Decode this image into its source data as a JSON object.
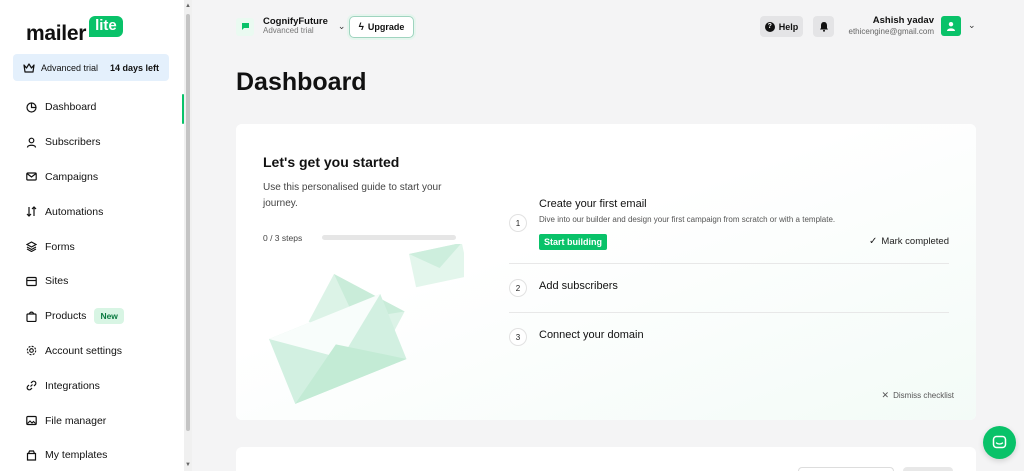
{
  "logo": {
    "text": "mailer",
    "badge": "lite"
  },
  "trial": {
    "label": "Advanced trial",
    "days_left": "14 days left"
  },
  "sidebar": {
    "items": [
      {
        "label": "Dashboard",
        "icon": "dashboard-icon",
        "active": true
      },
      {
        "label": "Subscribers",
        "icon": "user-icon"
      },
      {
        "label": "Campaigns",
        "icon": "mail-icon"
      },
      {
        "label": "Automations",
        "icon": "automation-icon"
      },
      {
        "label": "Forms",
        "icon": "layers-icon"
      },
      {
        "label": "Sites",
        "icon": "browser-icon"
      },
      {
        "label": "Products",
        "icon": "bag-icon",
        "badge": "New"
      },
      {
        "label": "Account settings",
        "icon": "gear-icon"
      },
      {
        "label": "Integrations",
        "icon": "link-icon"
      },
      {
        "label": "File manager",
        "icon": "image-icon"
      },
      {
        "label": "My templates",
        "icon": "template-icon"
      }
    ]
  },
  "account": {
    "name": "CognifyFuture",
    "plan": "Advanced trial"
  },
  "header": {
    "upgrade_label": "Upgrade",
    "help_label": "Help"
  },
  "user": {
    "name": "Ashish yadav",
    "email": "ethicengine@gmail.com"
  },
  "page": {
    "title": "Dashboard"
  },
  "guide": {
    "title": "Let's get you started",
    "description": "Use this personalised guide to start your journey.",
    "steps_count": "0 / 3 steps",
    "progress": 0,
    "dismiss_label": "Dismiss checklist",
    "steps": [
      {
        "num": "1",
        "title": "Create your first email",
        "subtitle": "Dive into our builder and design your first campaign from scratch or with a template.",
        "action": "Start building",
        "mark_completed": "Mark completed"
      },
      {
        "num": "2",
        "title": "Add subscribers"
      },
      {
        "num": "3",
        "title": "Connect your domain"
      }
    ]
  },
  "colors": {
    "brand": "#09c269",
    "trial_bg": "#e4f0fc"
  }
}
